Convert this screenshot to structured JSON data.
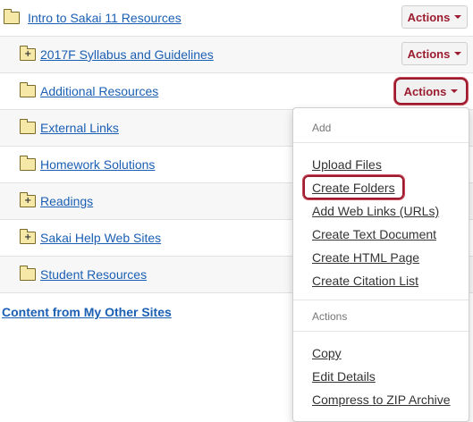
{
  "rows": [
    {
      "label": "Intro to Sakai 11 Resources",
      "has_plus": false,
      "actions": "Actions"
    },
    {
      "label": "2017F Syllabus and Guidelines",
      "has_plus": true,
      "actions": "Actions"
    },
    {
      "label": "Additional Resources",
      "has_plus": false,
      "actions": "Actions"
    },
    {
      "label": "External Links",
      "has_plus": false
    },
    {
      "label": "Homework Solutions",
      "has_plus": false
    },
    {
      "label": "Readings",
      "has_plus": true
    },
    {
      "label": "Sakai Help Web Sites",
      "has_plus": true
    },
    {
      "label": "Student Resources",
      "has_plus": false
    }
  ],
  "other_sites": "Content from My Other Sites",
  "menu": {
    "add_header": "Add",
    "add_items": [
      "Upload Files",
      "Create Folders",
      "Add Web Links (URLs)",
      "Create Text Document",
      "Create HTML Page",
      "Create Citation List"
    ],
    "actions_header": "Actions",
    "action_items": [
      "Copy",
      "Edit Details",
      "Compress to ZIP Archive"
    ]
  },
  "colors": {
    "accent": "#9b1c2e",
    "link": "#1a5fb4"
  }
}
